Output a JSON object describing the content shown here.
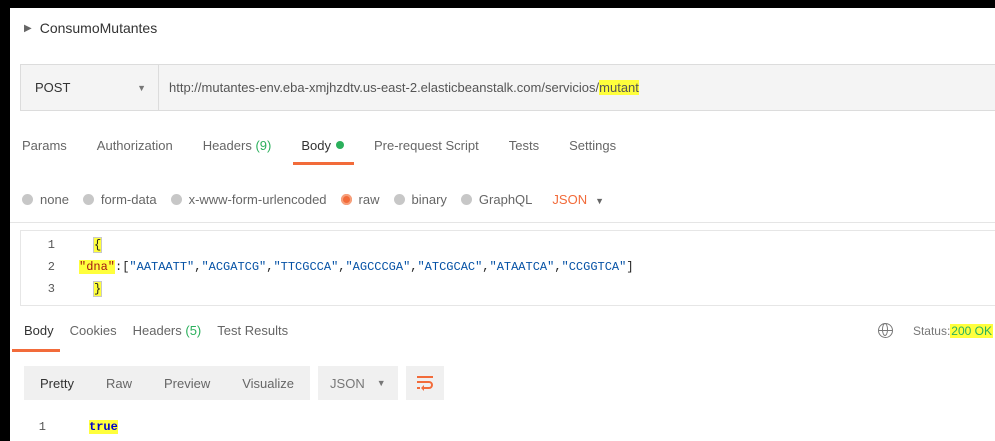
{
  "collection": {
    "name": "ConsumoMutantes"
  },
  "request": {
    "method": "POST",
    "url_prefix": "http://mutantes-env.eba-xmjhzdtv.us-east-2.elasticbeanstalk.com/servicios/",
    "url_highlight": "mutant"
  },
  "tabs": {
    "params": "Params",
    "authorization": "Authorization",
    "headers": "Headers",
    "headers_count": "(9)",
    "body": "Body",
    "prerequest": "Pre-request Script",
    "tests": "Tests",
    "settings": "Settings"
  },
  "body_modes": {
    "none": "none",
    "form_data": "form-data",
    "urlencoded": "x-www-form-urlencoded",
    "raw": "raw",
    "binary": "binary",
    "graphql": "GraphQL",
    "language": "JSON",
    "selected": "raw"
  },
  "editor": {
    "line_numbers": [
      "1",
      "2",
      "3"
    ],
    "open_brace": "{",
    "key": "\"dna\"",
    "colon_open": ":[",
    "strings": [
      "\"AATAATT\"",
      "\"ACGATCG\"",
      "\"TTCGCCA\"",
      "\"AGCCCGA\"",
      "\"ATCGCAC\"",
      "\"ATAATCA\"",
      "\"CCGGTCA\""
    ],
    "comma": ",",
    "close_bracket": "]",
    "close_brace": "}"
  },
  "response": {
    "tabs": {
      "body": "Body",
      "cookies": "Cookies",
      "headers": "Headers",
      "headers_count": "(5)",
      "test_results": "Test Results"
    },
    "status_label": "Status:",
    "status_value": "200 OK",
    "view": {
      "pretty": "Pretty",
      "raw": "Raw",
      "preview": "Preview",
      "visualize": "Visualize",
      "format": "JSON"
    },
    "output": {
      "line_number": "1",
      "value": "true"
    }
  },
  "colors": {
    "accent": "#f26b3a",
    "success": "#2bb05c",
    "highlight": "#ffff3c"
  },
  "icons": {
    "globe": "globe-icon",
    "wrap": "wrap-lines-icon",
    "caret": "chevron-down-icon",
    "collapse": "triangle-right-icon"
  }
}
